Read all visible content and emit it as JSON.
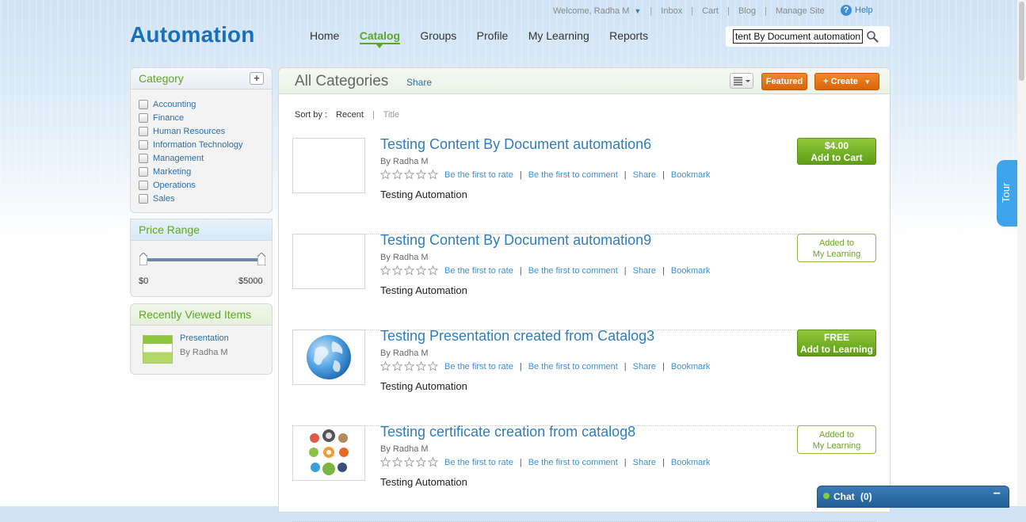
{
  "header": {
    "welcome": "Welcome, Radha M",
    "util_links": [
      "Inbox",
      "Cart",
      "Blog",
      "Manage Site"
    ],
    "help": "Help",
    "logo": "Automation",
    "nav": [
      {
        "label": "Home",
        "active": false
      },
      {
        "label": "Catalog",
        "active": true
      },
      {
        "label": "Groups",
        "active": false
      },
      {
        "label": "Profile",
        "active": false
      },
      {
        "label": "My Learning",
        "active": false
      },
      {
        "label": "Reports",
        "active": false
      }
    ],
    "search_value": "tent By Document automation"
  },
  "sidebar": {
    "category_title": "Category",
    "categories": [
      "Accounting",
      "Finance",
      "Human Resources",
      "Information Technology",
      "Management",
      "Marketing",
      "Operations",
      "Sales"
    ],
    "price_title": "Price Range",
    "price_min": "$0",
    "price_max": "$5000",
    "recent_title": "Recently Viewed Items",
    "recent": [
      {
        "title": "Presentation",
        "by": "By Radha M"
      }
    ]
  },
  "main": {
    "title": "All Categories",
    "share": "Share",
    "featured": "Featured",
    "create": "+ Create",
    "sort_label": "Sort by :",
    "sort_current": "Recent",
    "sort_alt": "Title",
    "rate_text": "Be the first to rate",
    "comment_text": "Be the first to comment",
    "share_text": "Share",
    "bookmark_text": "Bookmark",
    "items": [
      {
        "title": "Testing Content By Document automation6",
        "by": "By Radha M",
        "desc": "Testing Automation",
        "action_line1": "$4.00",
        "action_line2": "Add to Cart"
      },
      {
        "title": "Testing Content By Document automation9",
        "by": "By Radha M",
        "desc": "Testing Automation",
        "action_line1": "Added to",
        "action_line2": "My Learning"
      },
      {
        "title": "Testing Presentation created from Catalog3",
        "by": "By Radha M",
        "desc": "Testing Automation",
        "action_line1": "FREE",
        "action_line2": "Add to Learning"
      },
      {
        "title": "Testing certificate creation from catalog8",
        "by": "By Radha M",
        "desc": "Testing Automation",
        "action_line1": "Added to",
        "action_line2": "My Learning"
      }
    ]
  },
  "tour": "Tour",
  "chat": {
    "label": "Chat",
    "count": "(0)"
  },
  "colors": {
    "brand": "#1a6fb6",
    "accent_green": "#5ea624",
    "button_orange": "#e8761a"
  }
}
